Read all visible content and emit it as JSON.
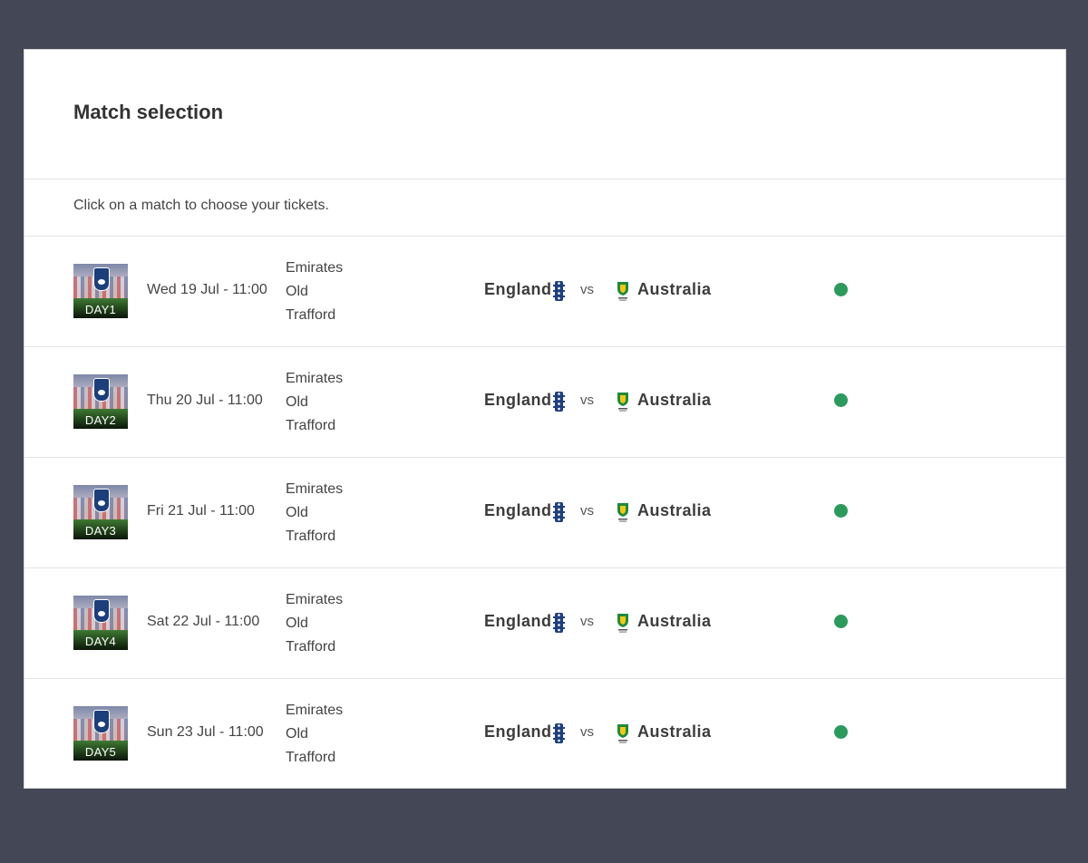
{
  "page": {
    "title": "Match selection",
    "instruction": "Click on a match to choose your tickets."
  },
  "colors": {
    "status_available": "#2d9a5d",
    "page_background": "#444756"
  },
  "matches": [
    {
      "day_label": "DAY1",
      "date": "Wed 19 Jul - 11:00",
      "venue": [
        "Emirates",
        "Old",
        "Trafford"
      ],
      "home_team": "England",
      "vs": "vs",
      "away_team": "Australia",
      "status_icon": "green-status-dot"
    },
    {
      "day_label": "DAY2",
      "date": "Thu 20 Jul - 11:00",
      "venue": [
        "Emirates",
        "Old",
        "Trafford"
      ],
      "home_team": "England",
      "vs": "vs",
      "away_team": "Australia",
      "status_icon": "green-status-dot"
    },
    {
      "day_label": "DAY3",
      "date": "Fri 21 Jul - 11:00",
      "venue": [
        "Emirates",
        "Old",
        "Trafford"
      ],
      "home_team": "England",
      "vs": "vs",
      "away_team": "Australia",
      "status_icon": "green-status-dot"
    },
    {
      "day_label": "DAY4",
      "date": "Sat 22 Jul - 11:00",
      "venue": [
        "Emirates",
        "Old",
        "Trafford"
      ],
      "home_team": "England",
      "vs": "vs",
      "away_team": "Australia",
      "status_icon": "green-status-dot"
    },
    {
      "day_label": "DAY5",
      "date": "Sun 23 Jul - 11:00",
      "venue": [
        "Emirates",
        "Old",
        "Trafford"
      ],
      "home_team": "England",
      "vs": "vs",
      "away_team": "Australia",
      "status_icon": "green-status-dot"
    }
  ]
}
